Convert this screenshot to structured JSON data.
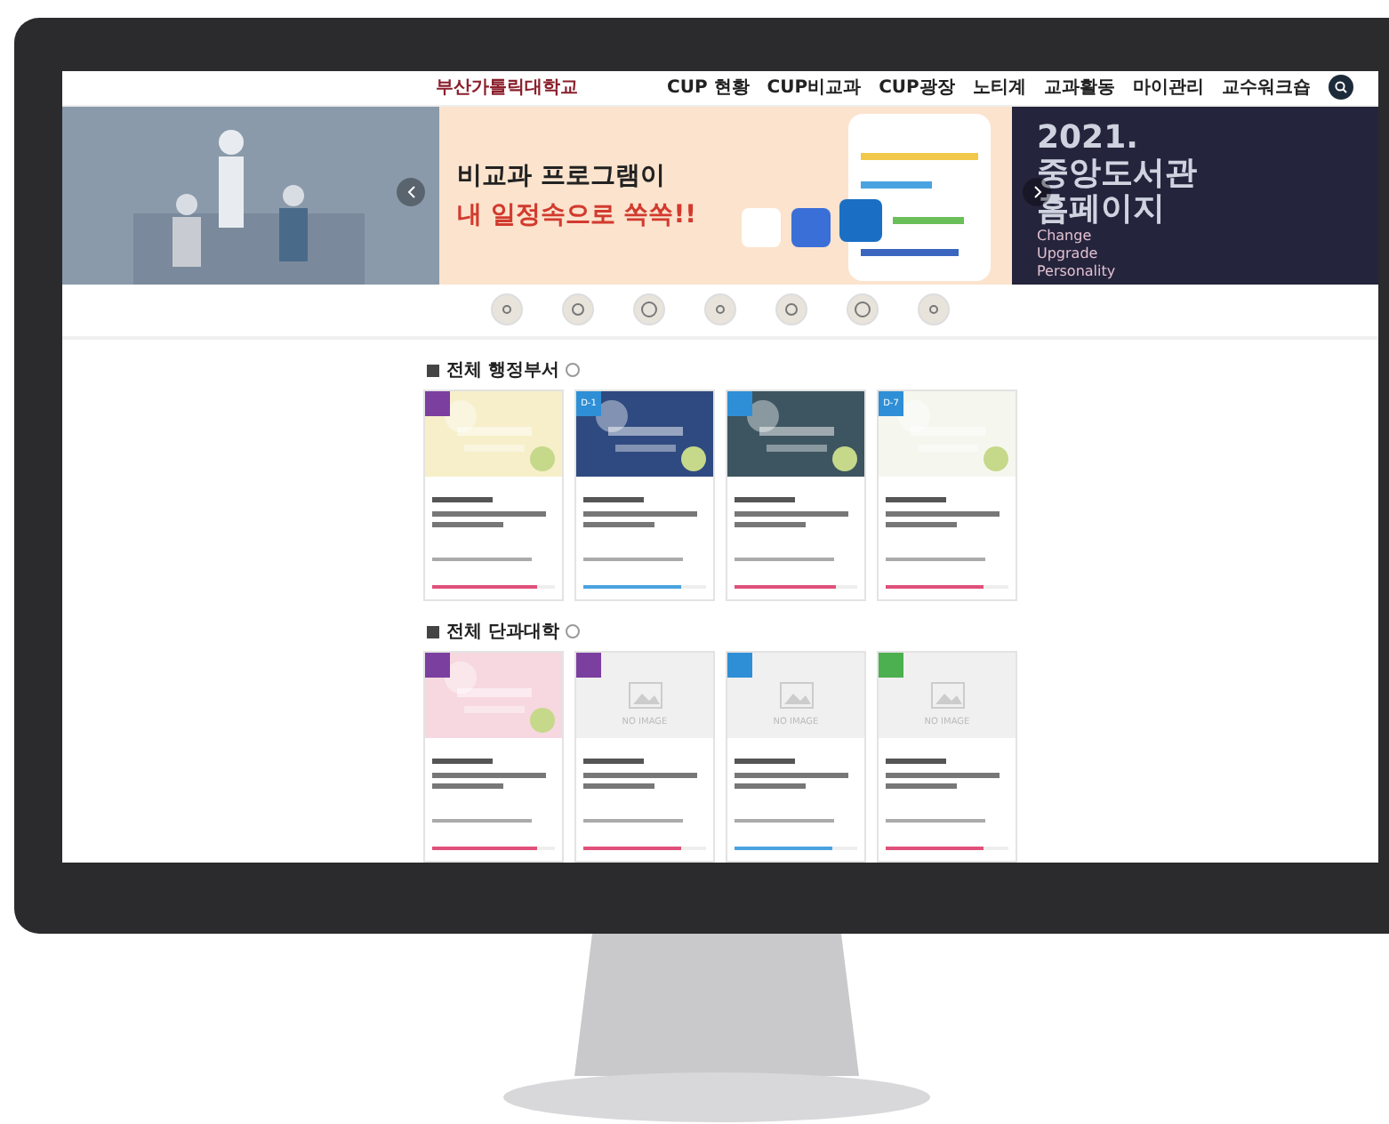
{
  "header": {
    "logo": "부산가톨릭대학교",
    "nav": [
      "CUP 현황",
      "CUP비교과",
      "CUP광장",
      "노티계",
      "교과활동",
      "마이관리",
      "교수워크숍"
    ]
  },
  "banner": {
    "title": "비교과 프로그램이",
    "highlight": "내 일정속으로 쏙쏙!!",
    "side_title": [
      "2021.",
      "중앙도서관",
      "홈페이지"
    ],
    "side_words": [
      "Change",
      "Upgrade",
      "Personality"
    ]
  },
  "categories": [
    {
      "color": "#e8e4dc"
    },
    {
      "color": "#e8e4dc"
    },
    {
      "color": "#e8e4dc"
    },
    {
      "color": "#e8e4dc"
    },
    {
      "color": "#e8e4dc"
    },
    {
      "color": "#e8e4dc"
    },
    {
      "color": "#e8e4dc"
    }
  ],
  "sections": [
    {
      "title": "전체 행정부서",
      "cards": [
        {
          "kind": "picture",
          "badge": {
            "color": "#7b3fa0"
          },
          "progress": {
            "color": "#e0507a",
            "level": 0.85
          }
        },
        {
          "kind": "picture",
          "badge": {
            "text": "D-1",
            "color": "#2f8fd6"
          },
          "progress": {
            "color": "#4aa3e0",
            "level": 0.8
          }
        },
        {
          "kind": "picture",
          "badge": {
            "color": "#2f8fd6"
          },
          "progress": {
            "color": "#e0507a",
            "level": 0.82
          }
        },
        {
          "kind": "picture",
          "badge": {
            "text": "D-7",
            "color": "#2f8fd6"
          },
          "progress": {
            "color": "#e0507a",
            "level": 0.8
          }
        }
      ]
    },
    {
      "title": "전체 단과대학",
      "cards": [
        {
          "kind": "picture",
          "badge": {
            "color": "#7b3fa0"
          },
          "progress": {
            "color": "#e0507a",
            "level": 0.85
          }
        },
        {
          "kind": "no_image",
          "no_image": "NO IMAGE",
          "badge": {
            "color": "#7b3fa0"
          },
          "progress": {
            "color": "#e0507a",
            "level": 0.8
          }
        },
        {
          "kind": "no_image",
          "no_image": "NO IMAGE",
          "badge": {
            "color": "#2f8fd6"
          },
          "progress": {
            "color": "#4aa3e0",
            "level": 0.8
          }
        },
        {
          "kind": "no_image",
          "no_image": "NO IMAGE",
          "badge": {
            "color": "#4caf50"
          },
          "progress": {
            "color": "#e0507a",
            "level": 0.8
          }
        }
      ]
    }
  ]
}
